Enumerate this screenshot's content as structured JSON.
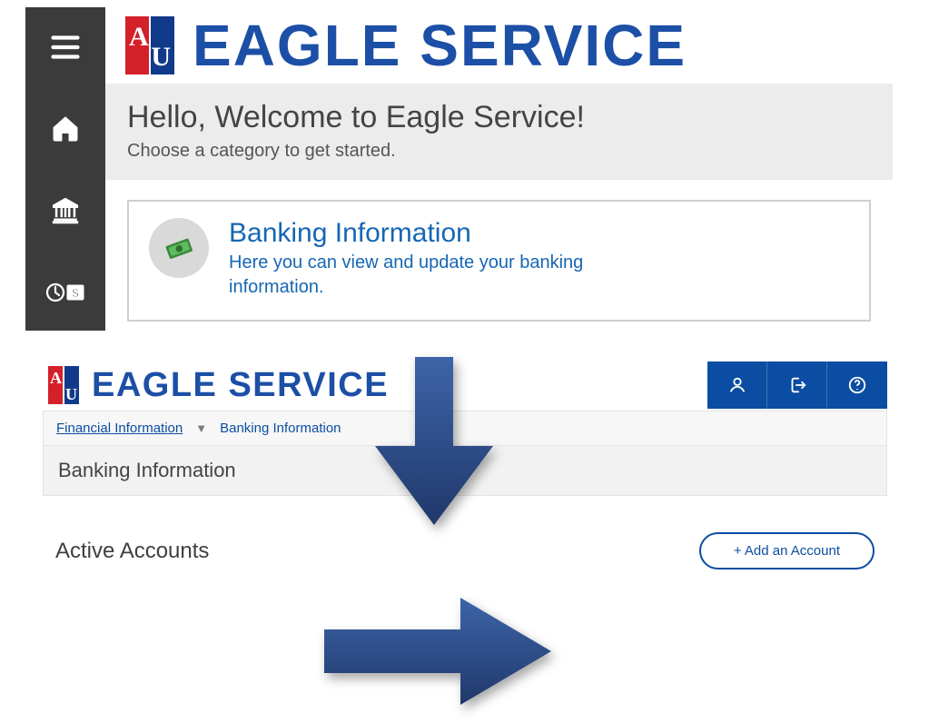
{
  "brand": {
    "logo_a": "A",
    "logo_u": "U",
    "title": "EAGLE SERVICE"
  },
  "welcome": {
    "heading": "Hello, Welcome to Eagle Service!",
    "sub": "Choose a category to get started."
  },
  "card": {
    "title": "Banking Information",
    "desc": "Here you can view and update your banking information."
  },
  "breadcrumb": {
    "parent": "Financial Information",
    "current": "Banking Information"
  },
  "page": {
    "heading": "Banking Information",
    "active_section": "Active Accounts",
    "add_button": "+ Add an Account"
  },
  "colors": {
    "primary": "#0b4da2",
    "brand_blue": "#1c4fa6",
    "brand_red": "#d42029",
    "arrow": "#2a4f94"
  }
}
